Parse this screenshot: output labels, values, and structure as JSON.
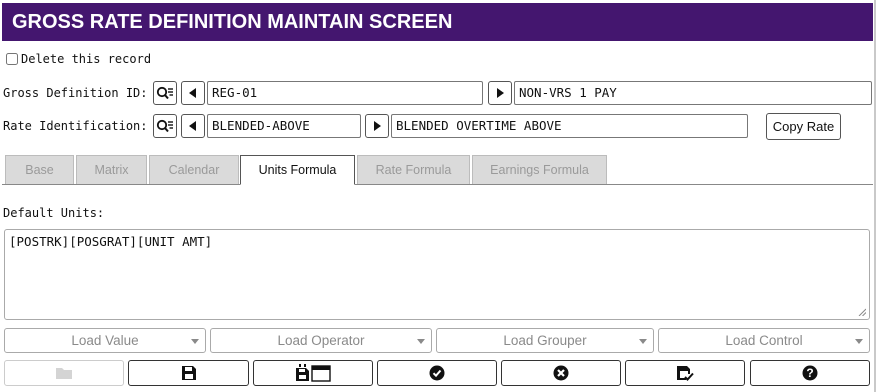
{
  "title": "GROSS RATE DEFINITION MAINTAIN SCREEN",
  "delete_label": "Delete this record",
  "gross_def": {
    "label": "Gross Definition ID:",
    "id_value": "REG-01",
    "desc_value": "NON-VRS 1 PAY"
  },
  "rate_ident": {
    "label": "Rate Identification:",
    "id_value": "BLENDED-ABOVE",
    "desc_value": "BLENDED OVERTIME ABOVE"
  },
  "copy_rate_label": "Copy Rate",
  "tabs": [
    {
      "label": "Base",
      "active": false
    },
    {
      "label": "Matrix",
      "active": false
    },
    {
      "label": "Calendar",
      "active": false
    },
    {
      "label": "Units Formula",
      "active": true
    },
    {
      "label": "Rate Formula",
      "active": false
    },
    {
      "label": "Earnings Formula",
      "active": false
    }
  ],
  "default_units_label": "Default Units:",
  "default_units_value": "[POSTRK][POSGRAT][UNIT AMT]",
  "dropdowns": {
    "load_value": "Load Value",
    "load_operator": "Load Operator",
    "load_grouper": "Load Grouper",
    "load_control": "Load Control"
  },
  "toolbar_icons": [
    "folder-icon",
    "save-icon",
    "save-window-icon",
    "check-circle-icon",
    "cancel-circle-icon",
    "save-check-icon",
    "help-icon"
  ],
  "colors": {
    "title_bar": "#44166f"
  }
}
